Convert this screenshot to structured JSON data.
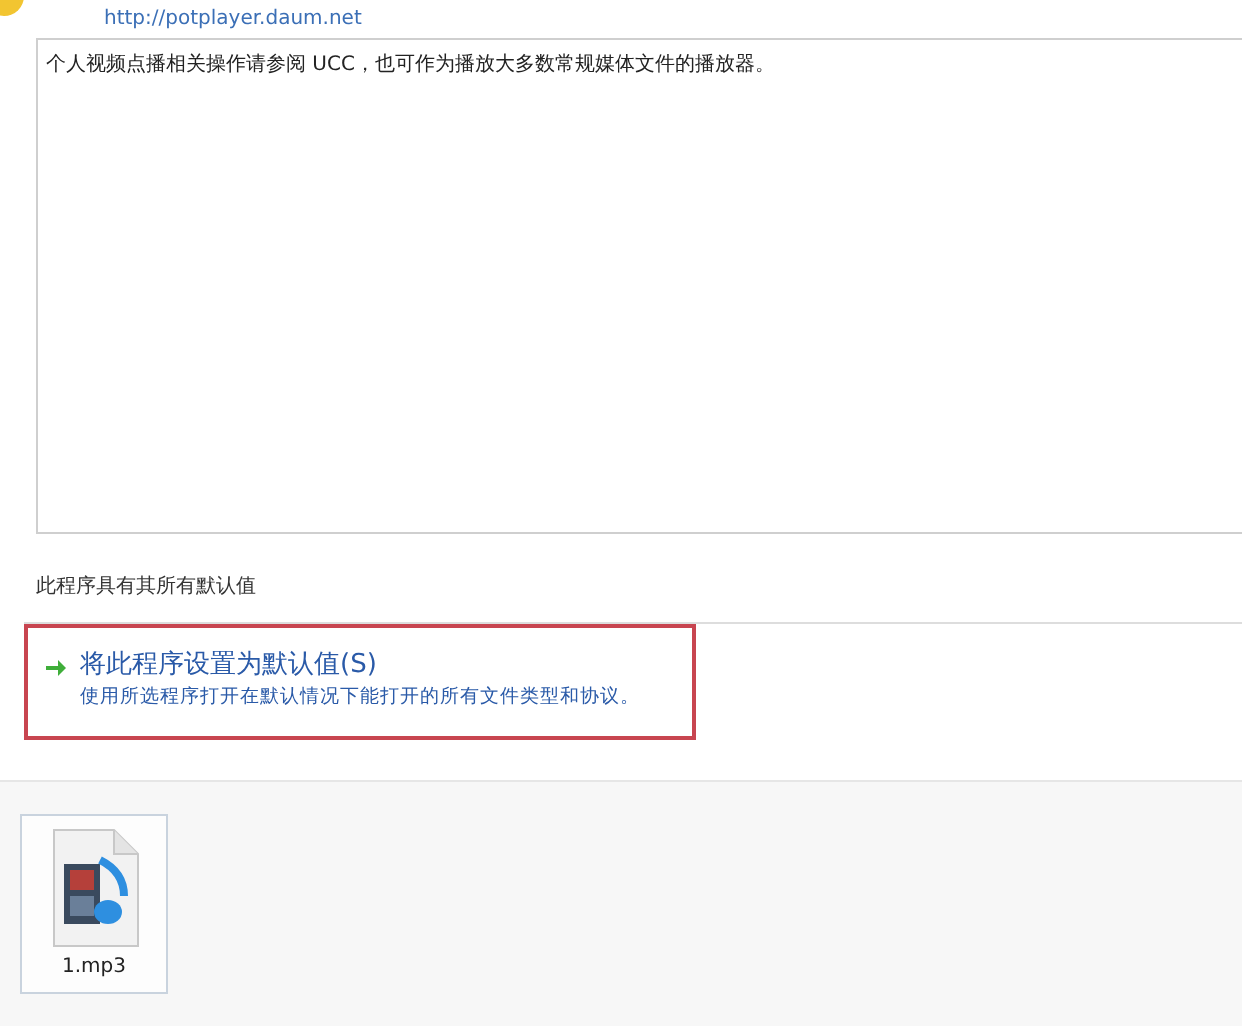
{
  "program": {
    "url": "http://potplayer.daum.net",
    "description": "个人视频点播相关操作请参阅 UCC，也可作为播放大多数常规媒体文件的播放器。"
  },
  "defaults_status": "此程序具有其所有默认值",
  "command_link": {
    "title": "将此程序设置为默认值(S)",
    "subtitle": "使用所选程序打开在默认情况下能打开的所有文件类型和协议。",
    "highlighted": true
  },
  "files": [
    {
      "name": "1.mp3",
      "selected": true
    }
  ]
}
